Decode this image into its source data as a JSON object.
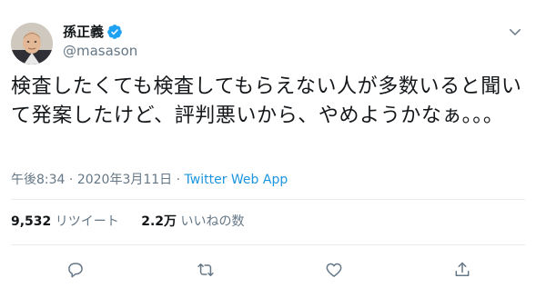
{
  "user": {
    "display_name": "孫正義",
    "handle": "@masason",
    "verified_icon": "verified-badge-icon",
    "badge_color": "#1da1f2"
  },
  "header": {
    "menu_icon": "chevron-down-icon"
  },
  "tweet": {
    "text": "検査したくても検査してもらえない人が多数いると聞いて発案したけど、評判悪いから、やめようかなぁ。。。"
  },
  "meta": {
    "time": "午後8:34",
    "separator": " · ",
    "date": "2020年3月11日",
    "app": "Twitter Web App"
  },
  "stats": {
    "retweets_count": "9,532",
    "retweets_label": "リツイート",
    "likes_count": "2.2万",
    "likes_label": "いいねの数"
  },
  "actions": [
    {
      "name": "reply-icon"
    },
    {
      "name": "retweet-icon"
    },
    {
      "name": "like-icon"
    },
    {
      "name": "share-icon"
    }
  ],
  "colors": {
    "text": "#14171a",
    "secondary": "#657786",
    "link": "#1b95e0",
    "divider": "#e6ecf0"
  }
}
